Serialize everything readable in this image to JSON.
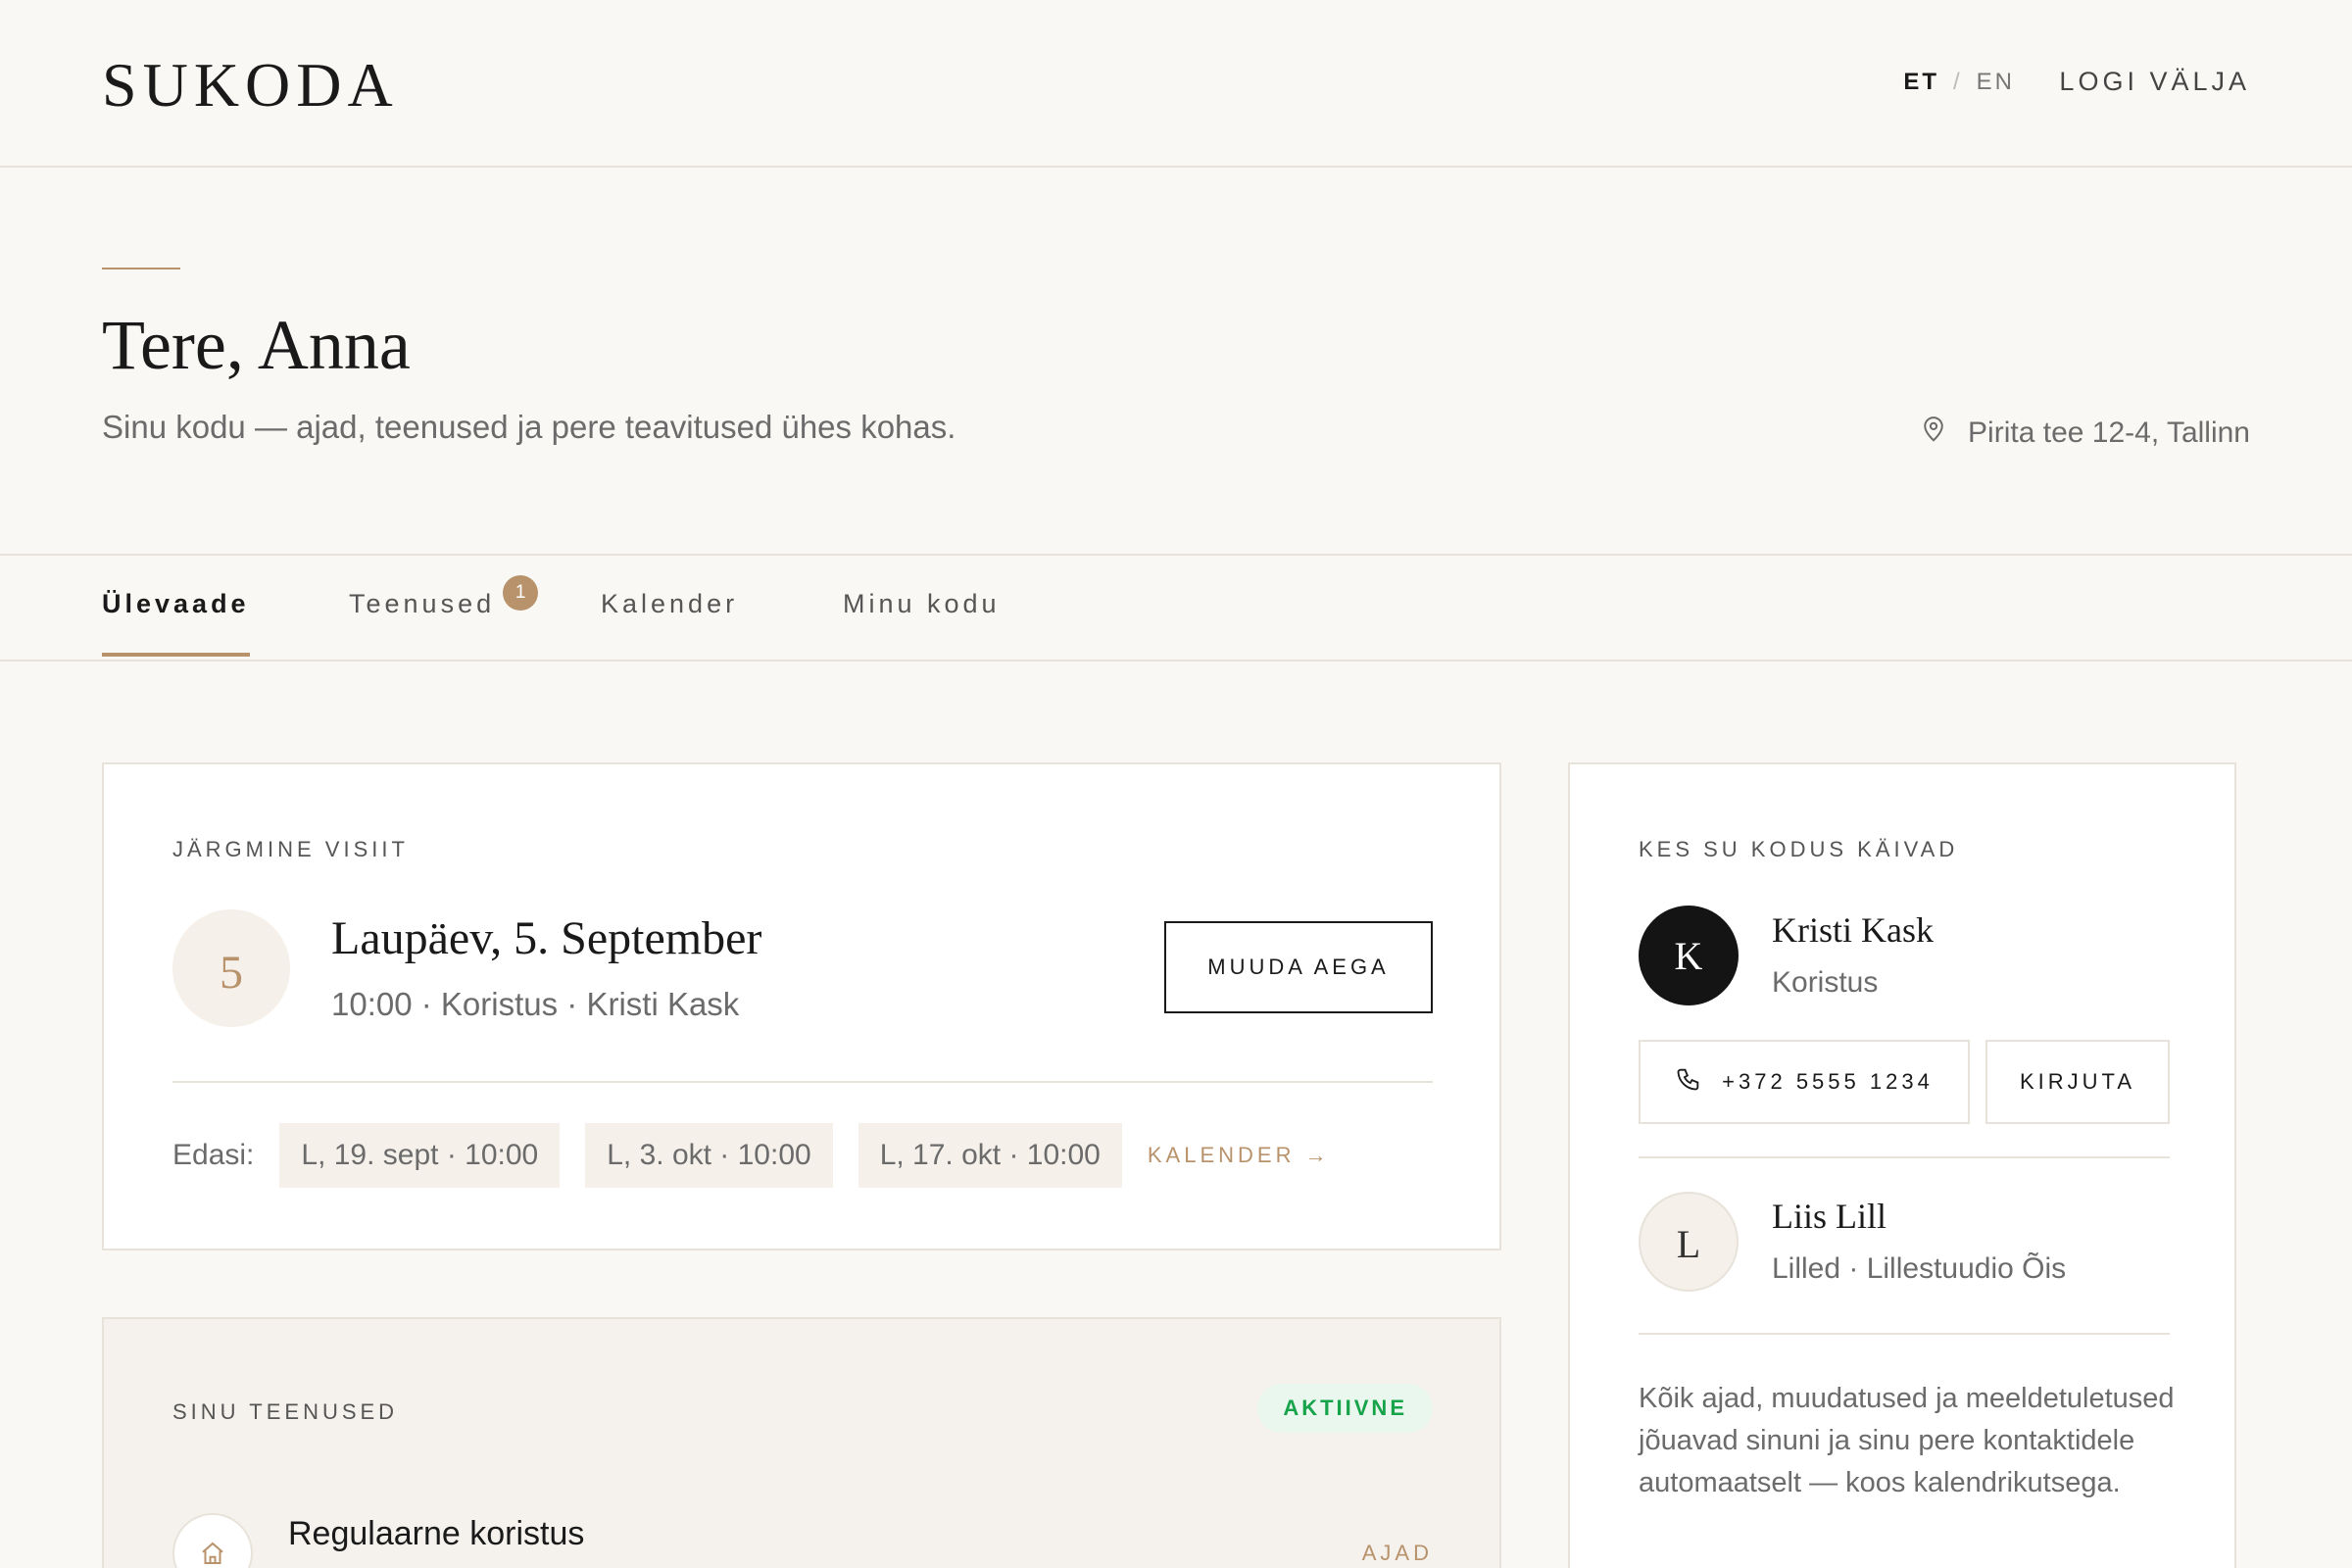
{
  "header": {
    "logo": "SUKODA",
    "lang_active": "ET",
    "lang_separator": "/",
    "lang_other": "EN",
    "logout_label": "LOGI VÄLJA"
  },
  "hero": {
    "greeting": "Tere, Anna",
    "subtitle": "Sinu kodu — ajad, teenused ja pere teavitused ühes kohas.",
    "address": "Pirita tee 12-4, Tallinn"
  },
  "tabs": [
    {
      "label": "Ülevaade",
      "active": true
    },
    {
      "label": "Teenused",
      "badge": "1"
    },
    {
      "label": "Kalender"
    },
    {
      "label": "Minu kodu"
    }
  ],
  "next_visit": {
    "label": "JÄRGMINE VISIIT",
    "day_number": "5",
    "date": "Laupäev, 5. September",
    "meta": "10:00 · Koristus · Kristi Kask",
    "change_button": "MUUDA AEGA",
    "upcoming_label": "Edasi:",
    "upcoming": [
      "L, 19. sept · 10:00",
      "L, 3. okt · 10:00",
      "L, 17. okt · 10:00"
    ],
    "calendar_link": "KALENDER →"
  },
  "services": {
    "label": "SINU TEENUSED",
    "status": "AKTIIVNE",
    "items": [
      {
        "name": "Regulaarne koristus",
        "link": "AJAD"
      }
    ]
  },
  "contacts": {
    "label": "KES SU KODUS KÄIVAD",
    "people": [
      {
        "initial": "K",
        "name": "Kristi Kask",
        "role": "Koristus",
        "phone": "+372 5555 1234",
        "write_label": "KIRJUTA"
      },
      {
        "initial": "L",
        "name": "Liis Lill",
        "role": "Lilled · Lillestuudio Õis"
      }
    ],
    "note": "Kõik ajad, muudatused ja meeldetuletused jõuavad sinuni ja sinu pere kontaktidele automaatselt — koos kalendrikutsega."
  },
  "colors": {
    "accent": "#b8926a",
    "background": "#faf8f4",
    "status_green": "#16a34a"
  },
  "icons": {
    "address": "map-pin-icon",
    "phone": "phone-icon",
    "service": "home-icon"
  }
}
